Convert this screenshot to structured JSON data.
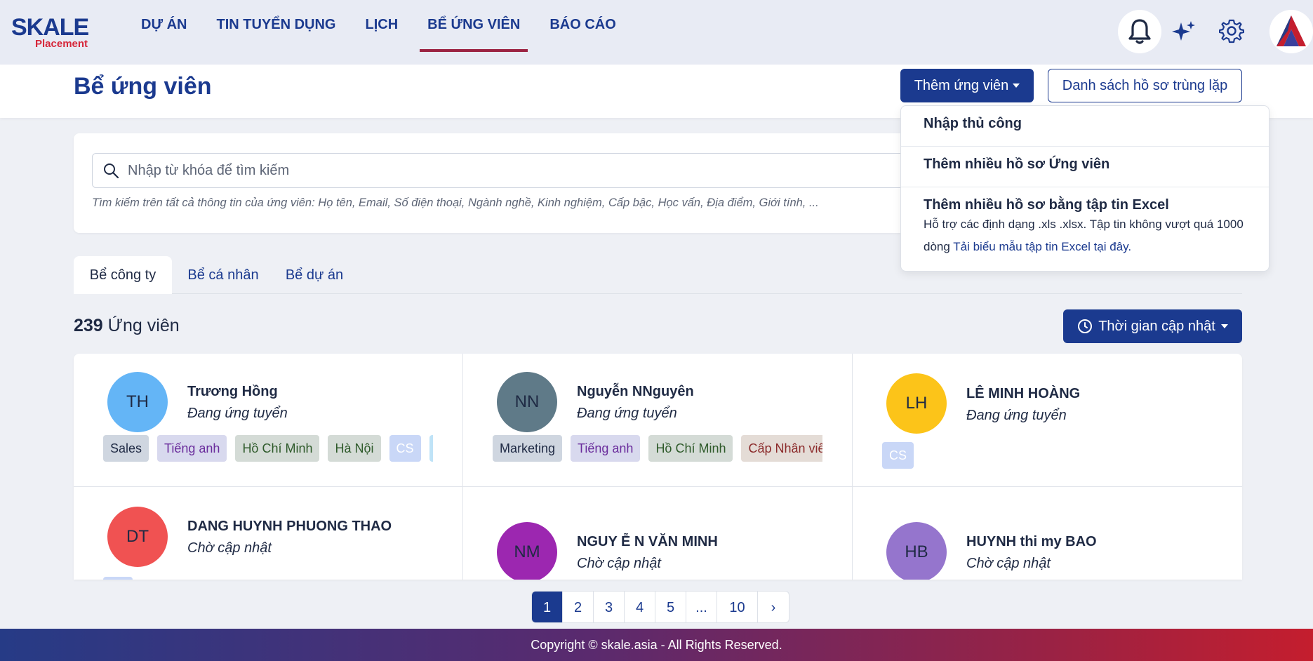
{
  "brand": {
    "logo_text": "SKALE",
    "logo_sub": "Placement"
  },
  "nav": {
    "items": [
      {
        "label": "DỰ ÁN"
      },
      {
        "label": "TIN TUYỂN DỤNG"
      },
      {
        "label": "LỊCH"
      },
      {
        "label": "BỂ ỨNG VIÊN",
        "active": true
      },
      {
        "label": "BÁO CÁO"
      }
    ],
    "icons": [
      "bell-icon",
      "sparkle-icon",
      "gear-icon",
      "user-avatar"
    ]
  },
  "header": {
    "title": "Bể ứng viên",
    "add_button": "Thêm ứng viên",
    "duplicate_button": "Danh sách hồ sơ trùng lặp"
  },
  "dropdown": {
    "items": [
      {
        "title": "Nhập thủ công"
      },
      {
        "title": "Thêm nhiều hồ sơ Ứng viên"
      },
      {
        "title": "Thêm nhiều hồ sơ bằng tập tin Excel",
        "desc": "Hỗ trợ các định dạng .xls .xlsx. Tập tin không vượt quá 1000 dòng",
        "link": "Tải biểu mẫu tập tin Excel tại đây."
      }
    ]
  },
  "search": {
    "placeholder": "Nhập từ khóa để tìm kiếm",
    "hint": "Tìm kiếm trên tất cả thông tin của ứng viên: Họ tên, Email, Số điện thoại, Ngành nghề, Kinh nghiệm, Cấp bậc, Học vấn, Địa điểm, Giới tính, ..."
  },
  "tabs": [
    {
      "label": "Bể công ty",
      "active": true
    },
    {
      "label": "Bể cá nhân"
    },
    {
      "label": "Bể dự án"
    }
  ],
  "summary": {
    "count": "239",
    "label": "Ứng viên",
    "sort_button": "Thời gian cập nhật"
  },
  "candidates": [
    {
      "initials": "TH",
      "name": "Trương Hồng",
      "status": "Đang ứng tuyển",
      "color": "#64b5f6",
      "tags": [
        {
          "text": "Sales",
          "bg": "#cfd6e0",
          "fg": "#1f2a44"
        },
        {
          "text": "Tiếng anh",
          "bg": "#d8d9ee",
          "fg": "#6a2c9c"
        },
        {
          "text": "Hồ Chí Minh",
          "bg": "#d4dbd6",
          "fg": "#2e5a2a"
        },
        {
          "text": "Hà Nội",
          "bg": "#d4dbd6",
          "fg": "#2e5a2a"
        },
        {
          "text": "CS",
          "bg": "#c9d7f7",
          "fg": "#ffffff"
        },
        {
          "text": "",
          "bg": "#bfe3f7",
          "fg": "#ffffff"
        }
      ]
    },
    {
      "initials": "NN",
      "name": "Nguyễn NNguyên",
      "status": "Đang ứng tuyển",
      "color": "#5f7a88",
      "tags": [
        {
          "text": "Marketing",
          "bg": "#cfd6e0",
          "fg": "#1f2a44"
        },
        {
          "text": "Tiếng anh",
          "bg": "#d8d9ee",
          "fg": "#6a2c9c"
        },
        {
          "text": "Hồ Chí Minh",
          "bg": "#d4dbd6",
          "fg": "#2e5a2a"
        },
        {
          "text": "Cấp Nhân viên",
          "bg": "#e4dcd6",
          "fg": "#8b2a2a"
        }
      ]
    },
    {
      "initials": "LH",
      "name": "LÊ MINH HOÀNG",
      "status": "Đang ứng tuyển",
      "color": "#fcc419",
      "tags": [
        {
          "text": "CS",
          "bg": "#c9d7f7",
          "fg": "#ffffff"
        }
      ]
    },
    {
      "initials": "DT",
      "name": "DANG HUYNH PHUONG THAO",
      "status": "Chờ cập nhật",
      "color": "#f05252",
      "tags": [
        {
          "text": "",
          "bg": "#c9d7f7",
          "fg": "#ffffff"
        }
      ]
    },
    {
      "initials": "NM",
      "name": "NGUY Ễ N VĂN MINH",
      "status": "Chờ cập nhật",
      "color": "#9c27b0",
      "tags": []
    },
    {
      "initials": "HB",
      "name": "HUYNH thi my BAO",
      "status": "Chờ cập nhật",
      "color": "#9575cd",
      "tags": []
    }
  ],
  "pagination": {
    "pages": [
      "1",
      "2",
      "3",
      "4",
      "5",
      "...",
      "10",
      "›"
    ],
    "current": "1"
  },
  "footer": {
    "text": "Copyright © skale.asia - All Rights Reserved."
  },
  "colors": {
    "primary": "#1b3a8f",
    "accent": "#9c2443",
    "brand_red": "#d6273a"
  }
}
